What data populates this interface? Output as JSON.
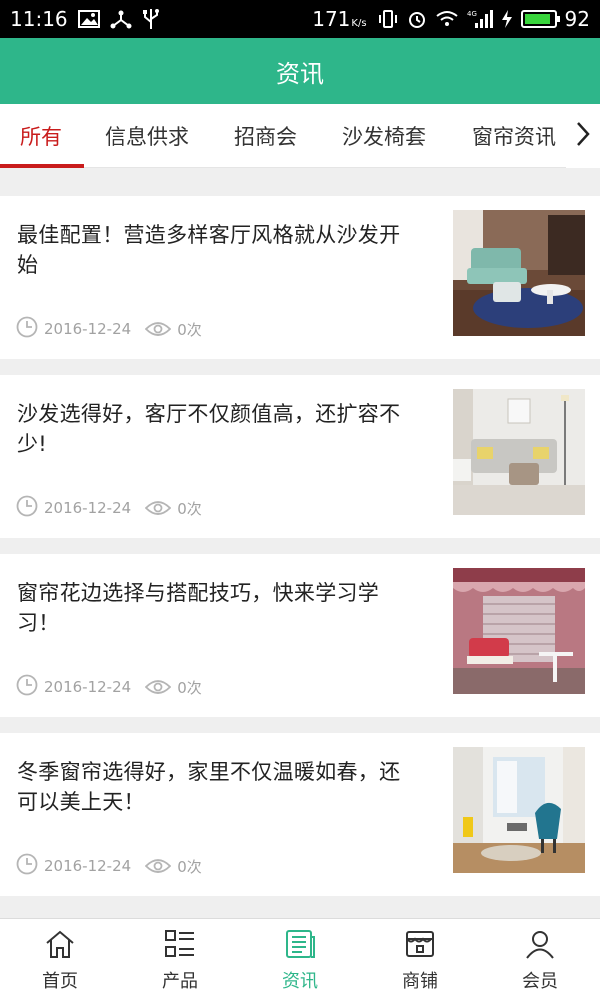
{
  "status_bar": {
    "time": "11:16",
    "net_speed": "171",
    "net_unit": "K/s",
    "network_type": "4G",
    "battery_level": "92",
    "battery_color": "#39d53c"
  },
  "header": {
    "title": "资讯",
    "background": "#2eb68a"
  },
  "tabs": [
    {
      "label": "所有",
      "active": true
    },
    {
      "label": "信息供求"
    },
    {
      "label": "招商会"
    },
    {
      "label": "沙发椅套"
    },
    {
      "label": "窗帘资讯"
    }
  ],
  "articles": [
    {
      "title": "最佳配置！营造多样客厅风格就从沙发开始",
      "date": "2016-12-24",
      "views": "0次",
      "image": "living-room-teal-sofa"
    },
    {
      "title": "沙发选得好，客厅不仅颜值高，还扩容不少!",
      "date": "2016-12-24",
      "views": "0次",
      "image": "living-room-grey-sofa"
    },
    {
      "title": "窗帘花边选择与搭配技巧，快来学习学习！",
      "date": "2016-12-24",
      "views": "0次",
      "image": "curtain-lace-chair"
    },
    {
      "title": "冬季窗帘选得好，家里不仅温暖如春，还可以美上天！",
      "date": "2016-12-24",
      "views": "0次",
      "image": "bright-room-blue-chair"
    }
  ],
  "bottom_nav": [
    {
      "label": "首页",
      "icon": "home-icon"
    },
    {
      "label": "产品",
      "icon": "product-list-icon"
    },
    {
      "label": "资讯",
      "icon": "news-icon",
      "active": true
    },
    {
      "label": "商铺",
      "icon": "store-icon"
    },
    {
      "label": "会员",
      "icon": "member-icon"
    }
  ],
  "colors": {
    "accent": "#2eb68a",
    "active_tab": "#c91c1c"
  }
}
